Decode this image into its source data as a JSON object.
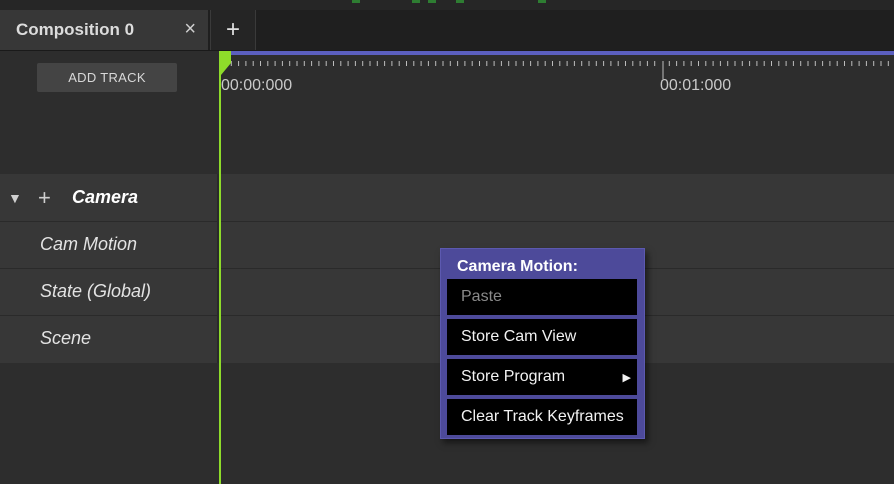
{
  "tabs": [
    {
      "label": "Composition 0",
      "close_symbol": "×"
    }
  ],
  "tab_add_symbol": "+",
  "toolbar": {
    "add_track_label": "ADD TRACK"
  },
  "timeline": {
    "time_labels": [
      "00:00:000",
      "00:01:000"
    ],
    "playhead_color": "#8edc2a",
    "bar_color": "#5b5fbf"
  },
  "tracks": {
    "group_name": "Camera",
    "expand_symbol": "▼",
    "add_symbol": "+",
    "items": [
      "Cam Motion",
      "State (Global)",
      "Scene"
    ]
  },
  "context_menu": {
    "title": "Camera Motion:",
    "items": [
      {
        "label": "Paste",
        "disabled": true
      },
      {
        "label": "Store Cam View",
        "disabled": false
      },
      {
        "label": "Store Program",
        "disabled": false,
        "submenu_symbol": "▶"
      },
      {
        "label": "Clear Track Keyframes",
        "disabled": false
      }
    ],
    "accent": "#4d4a9a"
  }
}
